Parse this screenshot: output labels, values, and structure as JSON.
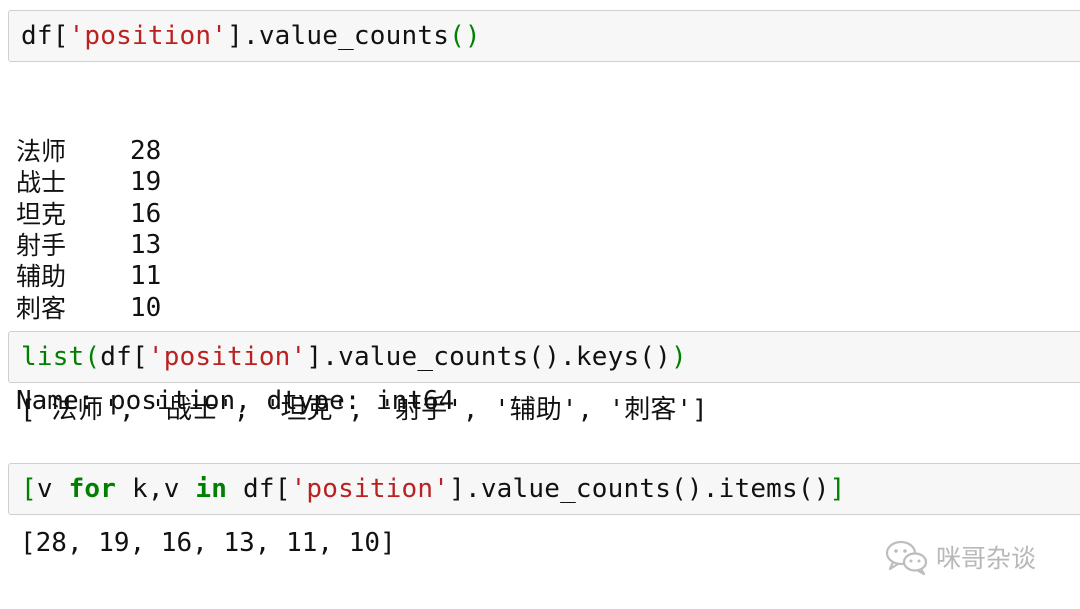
{
  "cells": {
    "cell1": {
      "input_tokens": [
        {
          "t": "df[",
          "c": ""
        },
        {
          "t": "'position'",
          "c": "str"
        },
        {
          "t": "].value_counts",
          "c": ""
        },
        {
          "t": "()",
          "c": "pg"
        }
      ],
      "output_rows": [
        {
          "key": "法师",
          "value": "28"
        },
        {
          "key": "战士",
          "value": "19"
        },
        {
          "key": "坦克",
          "value": "16"
        },
        {
          "key": "射手",
          "value": "13"
        },
        {
          "key": "辅助",
          "value": "11"
        },
        {
          "key": "刺客",
          "value": "10"
        }
      ],
      "output_footer": "Name: position, dtype: int64"
    },
    "cell2": {
      "input_tokens": [
        {
          "t": "list",
          "c": "bi"
        },
        {
          "t": "(",
          "c": "pg"
        },
        {
          "t": "df[",
          "c": ""
        },
        {
          "t": "'position'",
          "c": "str"
        },
        {
          "t": "].value_counts().keys()",
          "c": ""
        },
        {
          "t": ")",
          "c": "pg"
        }
      ],
      "output": "['法师', '战士', '坦克', '射手', '辅助', '刺客']"
    },
    "cell3": {
      "input_tokens": [
        {
          "t": "[",
          "c": "pg"
        },
        {
          "t": "v ",
          "c": ""
        },
        {
          "t": "for",
          "c": "kw"
        },
        {
          "t": " k,v ",
          "c": ""
        },
        {
          "t": "in",
          "c": "kw"
        },
        {
          "t": " df[",
          "c": ""
        },
        {
          "t": "'position'",
          "c": "str"
        },
        {
          "t": "].value_counts().items()",
          "c": ""
        },
        {
          "t": "]",
          "c": "pg"
        }
      ],
      "output": "[28, 19, 16, 13, 11, 10]"
    }
  },
  "watermark": {
    "text": "咪哥杂谈",
    "icon": "wechat-icon",
    "color": "#b8b8b8"
  }
}
